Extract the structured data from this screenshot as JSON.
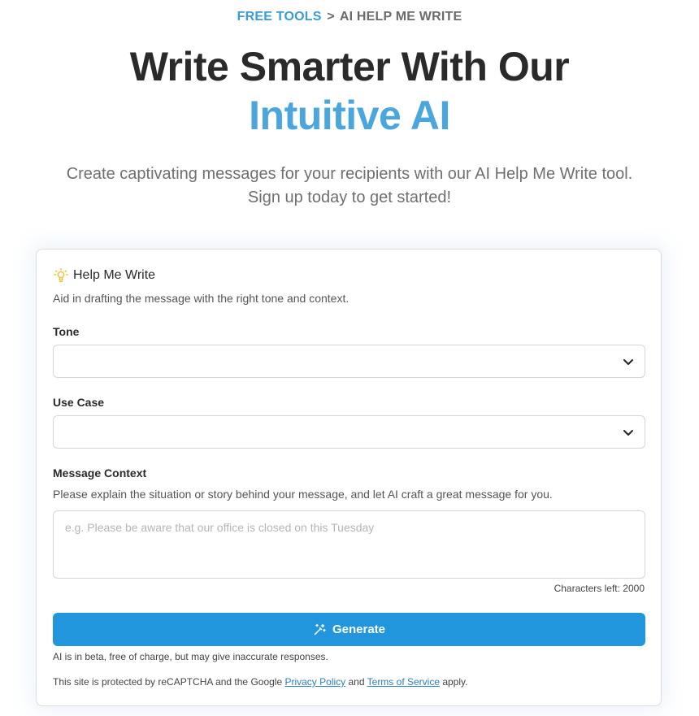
{
  "breadcrumb": {
    "parent": "FREE TOOLS",
    "separator": ">",
    "current": "AI HELP ME WRITE"
  },
  "hero": {
    "title_line1": "Write Smarter With Our",
    "title_line2": "Intuitive AI",
    "subtitle_line1": "Create captivating messages for your recipients with our AI Help Me Write tool.",
    "subtitle_line2": "Sign up today to get started!"
  },
  "card": {
    "icon": "lightbulb-icon",
    "title": "Help Me Write",
    "description": "Aid in drafting the message with the right tone and context.",
    "tone": {
      "label": "Tone",
      "value": ""
    },
    "use_case": {
      "label": "Use Case",
      "value": ""
    },
    "context": {
      "label": "Message Context",
      "help": "Please explain the situation or story behind your message, and let AI craft a great message for you.",
      "placeholder": "e.g. Please be aware that our office is closed on this Tuesday",
      "value": ""
    },
    "characters_left": "Characters left: 2000",
    "generate_label": "Generate",
    "beta_note": "AI is in beta, free of charge, but may give inaccurate responses.",
    "recaptcha": {
      "prefix": "This site is protected by reCAPTCHA and the Google ",
      "privacy": "Privacy Policy",
      "and": " and ",
      "terms": "Terms of Service",
      "suffix": " apply."
    }
  },
  "colors": {
    "accent": "#4aa6dc",
    "button": "#2196dc",
    "link": "#2b7fc0",
    "bulb": "#f2c12e"
  }
}
